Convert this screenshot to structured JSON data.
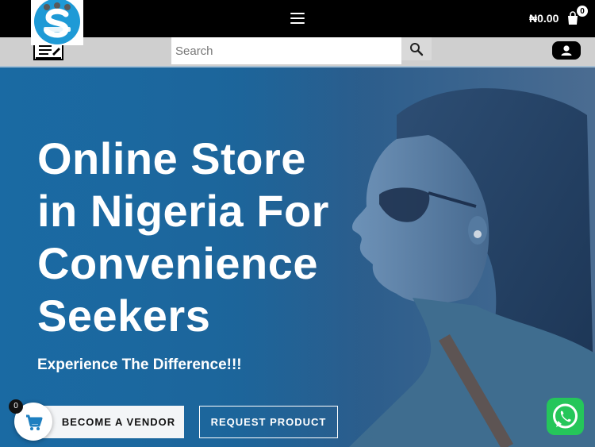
{
  "header": {
    "logo_alt": "Sevopens logo",
    "cart_total": "₦0.00",
    "cart_count": "0",
    "menu_icon": "hamburger-menu-icon",
    "cart_icon": "shopping-bag-icon"
  },
  "search": {
    "placeholder": "Search",
    "value": ""
  },
  "hero": {
    "title": "Online Store in Nigeria For Convenience Seekers",
    "subtitle": "Experience The Difference!!!",
    "primary_cta": "BECOME A VENDOR",
    "secondary_cta": "REQUEST PRODUCT"
  },
  "floating": {
    "cart_count": "0",
    "cart_icon": "cart-icon",
    "whatsapp_icon": "whatsapp-icon"
  },
  "colors": {
    "topbar": "#000000",
    "subbar": "#cfcfcf",
    "hero_blue": "#1d6499",
    "whatsapp": "#25c65a",
    "logo_blue": "#1e9ad6"
  }
}
